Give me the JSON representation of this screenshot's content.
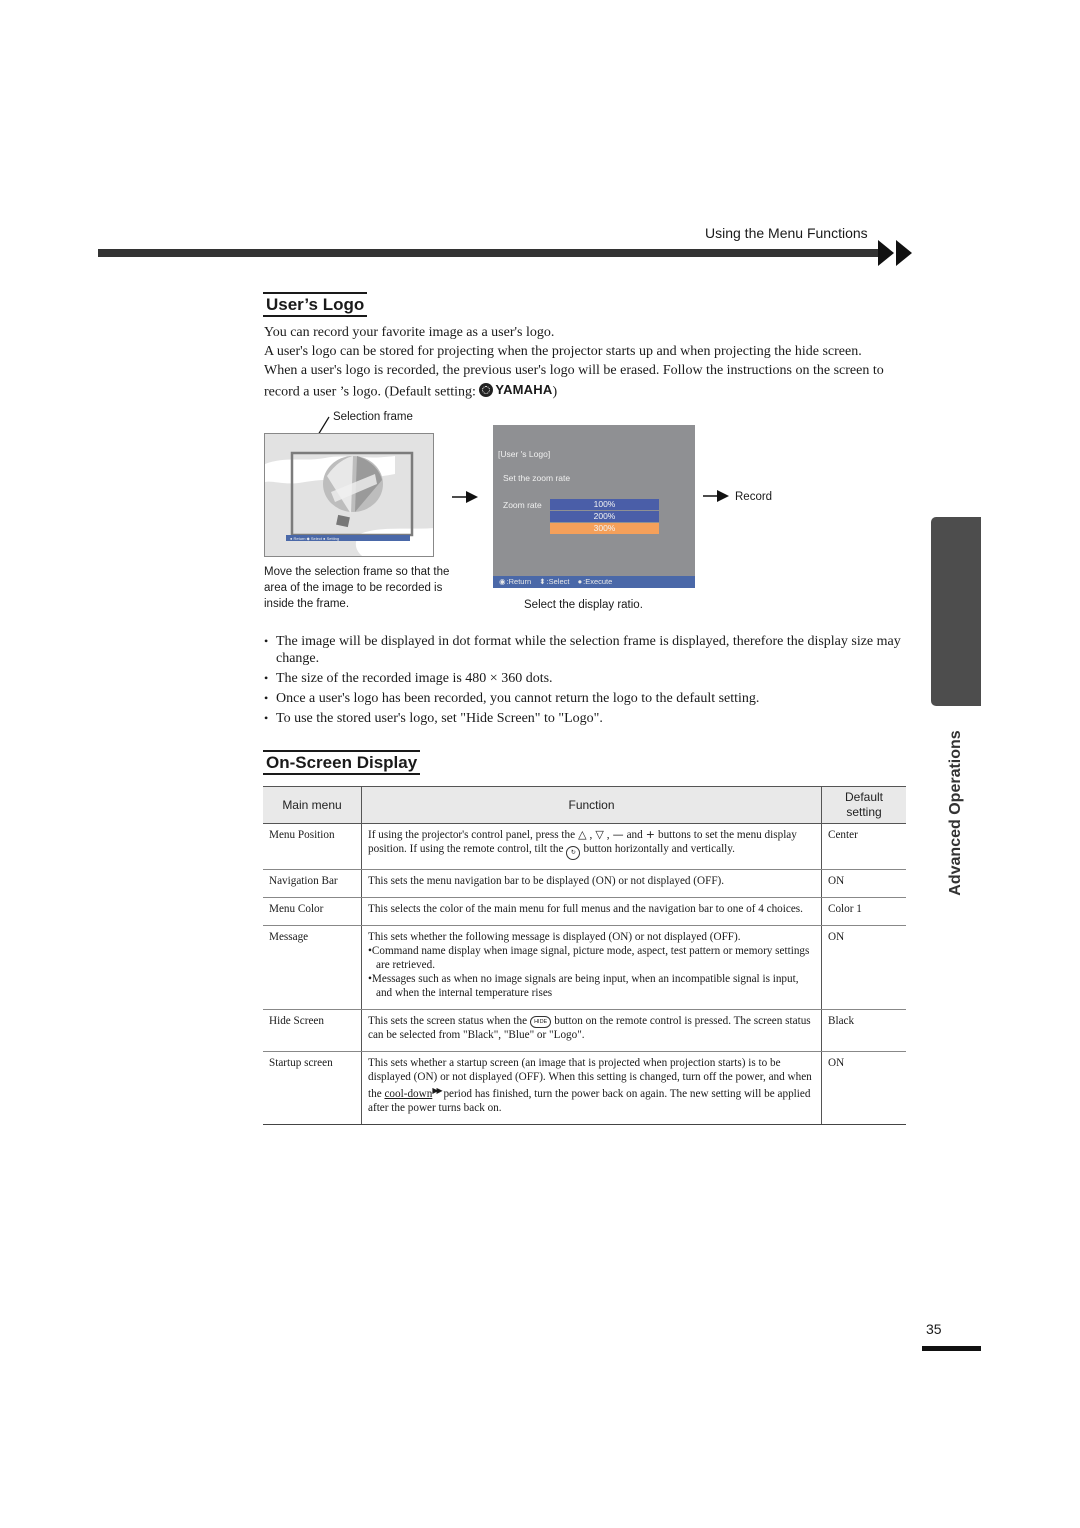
{
  "header": {
    "running_head": "Using the Menu Functions",
    "arrow_icon": "double-right-arrow"
  },
  "users_logo": {
    "title": "User’s Logo",
    "paragraphs": [
      "You can record your favorite image as a user's logo.",
      "A user's logo can be stored for projecting when the projector starts up and when projecting the hide screen.",
      "When a user's logo is recorded, the previous user's logo will be erased. Follow the instructions on the screen to record a user ’s logo. (Default setting: "
    ],
    "default_logo_text": "YAMAHA",
    "paragraph_close": ")",
    "figure": {
      "selection_frame_label": "Selection frame",
      "step1_caption": "Move the selection frame so that the area of the image to be recorded is inside the frame.",
      "step1_nav": [
        "Return",
        "Select",
        "Setting"
      ],
      "osd": {
        "title": "[User 's Logo]",
        "subtitle": "Set the zoom rate",
        "zoom_label": "Zoom rate",
        "options": [
          "100%",
          "200%",
          "300%"
        ],
        "highlighted_option": "300%",
        "nav": [
          ":Return",
          ":Select",
          ":Execute"
        ],
        "colors": {
          "background": "#8f9093",
          "option": "#4a5ea8",
          "highlight": "#f5a05a",
          "nav": "#4a68a8"
        }
      },
      "step2_caption": "Select the display ratio.",
      "record_label": "Record"
    },
    "notes": [
      "The image will be displayed in dot format while the selection frame is displayed, therefore the display size may change.",
      "The size of the recorded image is 480 × 360 dots.",
      "Once a user's logo has been recorded, you cannot return the logo to the default setting.",
      "To use the stored user's logo, set \"Hide Screen\" to \"Logo\"."
    ]
  },
  "osd_section": {
    "title": "On-Screen Display",
    "table": {
      "headers": [
        "Main menu",
        "Function",
        "Default setting"
      ],
      "rows": [
        {
          "menu": "Menu Position",
          "function_parts": [
            "If using the projector's control panel, press the",
            ",",
            ",",
            "and",
            "buttons to set the menu display position. If using the remote control, tilt the",
            "button horizontally and vertically."
          ],
          "glyphs": [
            "△",
            "▽",
            "—",
            "+"
          ],
          "default": "Center"
        },
        {
          "menu": "Navigation Bar",
          "function": "This sets the menu navigation bar to be displayed (ON) or not displayed (OFF).",
          "default": "ON"
        },
        {
          "menu": "Menu Color",
          "function": "This selects the color of the main menu for full menus and the navigation bar to one of 4 choices.",
          "default": "Color 1"
        },
        {
          "menu": "Message",
          "function": "This sets whether the following message is displayed (ON) or not displayed (OFF).",
          "sub_items": [
            "Command name display when image signal, picture mode, aspect, test pattern or memory settings are retrieved.",
            "Messages such as when no image signals are being input, when an incompatible signal is input, and when the internal temperature rises"
          ],
          "default": "ON"
        },
        {
          "menu": "Hide Screen",
          "function_parts": [
            "This sets the screen status when the",
            "button on the remote control is pressed. The screen status can be selected from \"Black\", \"Blue\" or \"Logo\"."
          ],
          "button_label": "HIDE",
          "default": "Black"
        },
        {
          "menu": "Startup screen",
          "function_parts": [
            "This sets whether a startup screen (an image that is projected when projection starts) is to be displayed (ON) or not displayed (OFF). When this setting is changed, turn off the power, and when the",
            "cool-down",
            "period has finished, turn the power back on again. The new setting will be applied after the power turns back on."
          ],
          "default": "ON"
        }
      ]
    }
  },
  "side_tab": {
    "label": "Advanced Operations"
  },
  "page_number": "35"
}
